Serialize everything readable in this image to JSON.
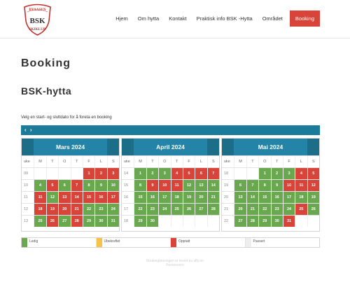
{
  "logo": {
    "top_text": "BYAASEN",
    "bottom_text": "SKIKLUB",
    "mark": "BSK"
  },
  "nav": {
    "items": [
      "Hjem",
      "Om hytta",
      "Kontakt",
      "Praktisk info BSK -Hytta",
      "Området"
    ],
    "booking": "Booking"
  },
  "page_title": "Booking",
  "section_title": "BSK-hytta",
  "instruction": "Velg en start- og sluttdato for å foreta en booking",
  "calendar": {
    "prev": "‹",
    "next": "›",
    "weekday_headers": [
      "uke",
      "M",
      "T",
      "O",
      "T",
      "F",
      "L",
      "S"
    ],
    "months": [
      {
        "name": "Mars 2024",
        "rows": [
          {
            "week": "09",
            "days": [
              null,
              null,
              null,
              null,
              {
                "d": "1",
                "s": "r"
              },
              {
                "d": "2",
                "s": "r"
              },
              {
                "d": "3",
                "s": "r"
              }
            ]
          },
          {
            "week": "10",
            "days": [
              {
                "d": "4",
                "s": "g"
              },
              {
                "d": "5",
                "s": "r"
              },
              {
                "d": "6",
                "s": "g"
              },
              {
                "d": "7",
                "s": "r"
              },
              {
                "d": "8",
                "s": "g"
              },
              {
                "d": "9",
                "s": "g"
              },
              {
                "d": "10",
                "s": "g"
              }
            ]
          },
          {
            "week": "11",
            "days": [
              {
                "d": "11",
                "s": "r"
              },
              {
                "d": "12",
                "s": "g"
              },
              {
                "d": "13",
                "s": "r"
              },
              {
                "d": "14",
                "s": "r"
              },
              {
                "d": "15",
                "s": "r"
              },
              {
                "d": "16",
                "s": "r"
              },
              {
                "d": "17",
                "s": "r"
              }
            ]
          },
          {
            "week": "12",
            "days": [
              {
                "d": "18",
                "s": "r"
              },
              {
                "d": "19",
                "s": "r"
              },
              {
                "d": "20",
                "s": "r"
              },
              {
                "d": "21",
                "s": "r"
              },
              {
                "d": "22",
                "s": "g"
              },
              {
                "d": "23",
                "s": "g"
              },
              {
                "d": "24",
                "s": "g"
              }
            ]
          },
          {
            "week": "13",
            "days": [
              {
                "d": "25",
                "s": "g"
              },
              {
                "d": "26",
                "s": "r"
              },
              {
                "d": "27",
                "s": "g"
              },
              {
                "d": "28",
                "s": "r"
              },
              {
                "d": "29",
                "s": "g"
              },
              {
                "d": "30",
                "s": "g"
              },
              {
                "d": "31",
                "s": "g"
              }
            ]
          }
        ]
      },
      {
        "name": "April 2024",
        "rows": [
          {
            "week": "14",
            "days": [
              {
                "d": "1",
                "s": "g"
              },
              {
                "d": "2",
                "s": "g"
              },
              {
                "d": "3",
                "s": "g"
              },
              {
                "d": "4",
                "s": "r"
              },
              {
                "d": "5",
                "s": "r"
              },
              {
                "d": "6",
                "s": "r"
              },
              {
                "d": "7",
                "s": "r"
              }
            ]
          },
          {
            "week": "15",
            "days": [
              {
                "d": "8",
                "s": "g"
              },
              {
                "d": "9",
                "s": "r"
              },
              {
                "d": "10",
                "s": "r"
              },
              {
                "d": "11",
                "s": "r"
              },
              {
                "d": "12",
                "s": "g"
              },
              {
                "d": "13",
                "s": "g"
              },
              {
                "d": "14",
                "s": "g"
              }
            ]
          },
          {
            "week": "16",
            "days": [
              {
                "d": "15",
                "s": "g"
              },
              {
                "d": "16",
                "s": "g"
              },
              {
                "d": "17",
                "s": "g"
              },
              {
                "d": "18",
                "s": "g"
              },
              {
                "d": "19",
                "s": "g"
              },
              {
                "d": "20",
                "s": "g"
              },
              {
                "d": "21",
                "s": "g"
              }
            ]
          },
          {
            "week": "17",
            "days": [
              {
                "d": "22",
                "s": "g"
              },
              {
                "d": "23",
                "s": "g"
              },
              {
                "d": "24",
                "s": "g"
              },
              {
                "d": "25",
                "s": "g"
              },
              {
                "d": "26",
                "s": "g"
              },
              {
                "d": "27",
                "s": "g"
              },
              {
                "d": "28",
                "s": "g"
              }
            ]
          },
          {
            "week": "18",
            "days": [
              {
                "d": "29",
                "s": "g"
              },
              {
                "d": "30",
                "s": "g"
              },
              null,
              null,
              null,
              null,
              null
            ]
          }
        ]
      },
      {
        "name": "Mai 2024",
        "rows": [
          {
            "week": "18",
            "days": [
              null,
              null,
              {
                "d": "1",
                "s": "g"
              },
              {
                "d": "2",
                "s": "g"
              },
              {
                "d": "3",
                "s": "g"
              },
              {
                "d": "4",
                "s": "r"
              },
              {
                "d": "5",
                "s": "r"
              }
            ]
          },
          {
            "week": "19",
            "days": [
              {
                "d": "6",
                "s": "g"
              },
              {
                "d": "7",
                "s": "g"
              },
              {
                "d": "8",
                "s": "g"
              },
              {
                "d": "9",
                "s": "g"
              },
              {
                "d": "10",
                "s": "r"
              },
              {
                "d": "11",
                "s": "r"
              },
              {
                "d": "12",
                "s": "r"
              }
            ]
          },
          {
            "week": "20",
            "days": [
              {
                "d": "13",
                "s": "g"
              },
              {
                "d": "14",
                "s": "g"
              },
              {
                "d": "15",
                "s": "g"
              },
              {
                "d": "16",
                "s": "g"
              },
              {
                "d": "17",
                "s": "g"
              },
              {
                "d": "18",
                "s": "g"
              },
              {
                "d": "19",
                "s": "g"
              }
            ]
          },
          {
            "week": "21",
            "days": [
              {
                "d": "20",
                "s": "g"
              },
              {
                "d": "21",
                "s": "g"
              },
              {
                "d": "22",
                "s": "g"
              },
              {
                "d": "23",
                "s": "g"
              },
              {
                "d": "24",
                "s": "g"
              },
              {
                "d": "25",
                "s": "r"
              },
              {
                "d": "26",
                "s": "g"
              }
            ]
          },
          {
            "week": "22",
            "days": [
              {
                "d": "27",
                "s": "g"
              },
              {
                "d": "28",
                "s": "g"
              },
              {
                "d": "29",
                "s": "g"
              },
              {
                "d": "30",
                "s": "g"
              },
              {
                "d": "31",
                "s": "r"
              },
              null,
              null
            ]
          }
        ]
      }
    ]
  },
  "legend": [
    {
      "label": "Ledig",
      "color": "#6aa84f"
    },
    {
      "label": "Ubekreftet",
      "color": "#f6c24a"
    },
    {
      "label": "Opptatt",
      "color": "#d9443a"
    },
    {
      "label": "Passert",
      "color": "#eeeeee"
    }
  ],
  "footer": {
    "line1": "Bookingløsningen er levert av affy.no",
    "line2": "Personvern"
  },
  "colors": {
    "accent": "#d9443a",
    "calendar_bar": "#1b7b9b",
    "month_header": "#2484a7"
  }
}
